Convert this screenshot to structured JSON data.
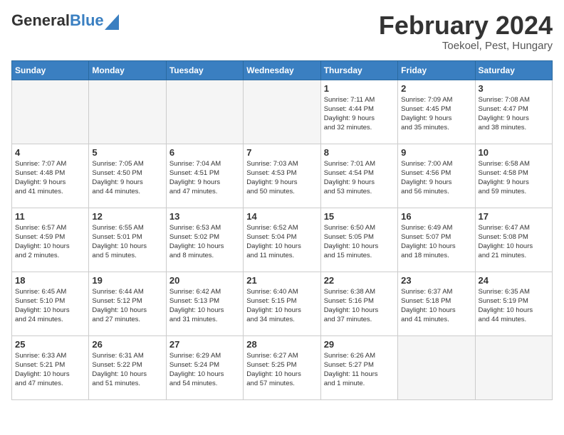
{
  "header": {
    "logo_general": "General",
    "logo_blue": "Blue",
    "title": "February 2024",
    "subtitle": "Toekoel, Pest, Hungary"
  },
  "days_of_week": [
    "Sunday",
    "Monday",
    "Tuesday",
    "Wednesday",
    "Thursday",
    "Friday",
    "Saturday"
  ],
  "weeks": [
    [
      {
        "day": "",
        "info": ""
      },
      {
        "day": "",
        "info": ""
      },
      {
        "day": "",
        "info": ""
      },
      {
        "day": "",
        "info": ""
      },
      {
        "day": "1",
        "info": "Sunrise: 7:11 AM\nSunset: 4:44 PM\nDaylight: 9 hours\nand 32 minutes."
      },
      {
        "day": "2",
        "info": "Sunrise: 7:09 AM\nSunset: 4:45 PM\nDaylight: 9 hours\nand 35 minutes."
      },
      {
        "day": "3",
        "info": "Sunrise: 7:08 AM\nSunset: 4:47 PM\nDaylight: 9 hours\nand 38 minutes."
      }
    ],
    [
      {
        "day": "4",
        "info": "Sunrise: 7:07 AM\nSunset: 4:48 PM\nDaylight: 9 hours\nand 41 minutes."
      },
      {
        "day": "5",
        "info": "Sunrise: 7:05 AM\nSunset: 4:50 PM\nDaylight: 9 hours\nand 44 minutes."
      },
      {
        "day": "6",
        "info": "Sunrise: 7:04 AM\nSunset: 4:51 PM\nDaylight: 9 hours\nand 47 minutes."
      },
      {
        "day": "7",
        "info": "Sunrise: 7:03 AM\nSunset: 4:53 PM\nDaylight: 9 hours\nand 50 minutes."
      },
      {
        "day": "8",
        "info": "Sunrise: 7:01 AM\nSunset: 4:54 PM\nDaylight: 9 hours\nand 53 minutes."
      },
      {
        "day": "9",
        "info": "Sunrise: 7:00 AM\nSunset: 4:56 PM\nDaylight: 9 hours\nand 56 minutes."
      },
      {
        "day": "10",
        "info": "Sunrise: 6:58 AM\nSunset: 4:58 PM\nDaylight: 9 hours\nand 59 minutes."
      }
    ],
    [
      {
        "day": "11",
        "info": "Sunrise: 6:57 AM\nSunset: 4:59 PM\nDaylight: 10 hours\nand 2 minutes."
      },
      {
        "day": "12",
        "info": "Sunrise: 6:55 AM\nSunset: 5:01 PM\nDaylight: 10 hours\nand 5 minutes."
      },
      {
        "day": "13",
        "info": "Sunrise: 6:53 AM\nSunset: 5:02 PM\nDaylight: 10 hours\nand 8 minutes."
      },
      {
        "day": "14",
        "info": "Sunrise: 6:52 AM\nSunset: 5:04 PM\nDaylight: 10 hours\nand 11 minutes."
      },
      {
        "day": "15",
        "info": "Sunrise: 6:50 AM\nSunset: 5:05 PM\nDaylight: 10 hours\nand 15 minutes."
      },
      {
        "day": "16",
        "info": "Sunrise: 6:49 AM\nSunset: 5:07 PM\nDaylight: 10 hours\nand 18 minutes."
      },
      {
        "day": "17",
        "info": "Sunrise: 6:47 AM\nSunset: 5:08 PM\nDaylight: 10 hours\nand 21 minutes."
      }
    ],
    [
      {
        "day": "18",
        "info": "Sunrise: 6:45 AM\nSunset: 5:10 PM\nDaylight: 10 hours\nand 24 minutes."
      },
      {
        "day": "19",
        "info": "Sunrise: 6:44 AM\nSunset: 5:12 PM\nDaylight: 10 hours\nand 27 minutes."
      },
      {
        "day": "20",
        "info": "Sunrise: 6:42 AM\nSunset: 5:13 PM\nDaylight: 10 hours\nand 31 minutes."
      },
      {
        "day": "21",
        "info": "Sunrise: 6:40 AM\nSunset: 5:15 PM\nDaylight: 10 hours\nand 34 minutes."
      },
      {
        "day": "22",
        "info": "Sunrise: 6:38 AM\nSunset: 5:16 PM\nDaylight: 10 hours\nand 37 minutes."
      },
      {
        "day": "23",
        "info": "Sunrise: 6:37 AM\nSunset: 5:18 PM\nDaylight: 10 hours\nand 41 minutes."
      },
      {
        "day": "24",
        "info": "Sunrise: 6:35 AM\nSunset: 5:19 PM\nDaylight: 10 hours\nand 44 minutes."
      }
    ],
    [
      {
        "day": "25",
        "info": "Sunrise: 6:33 AM\nSunset: 5:21 PM\nDaylight: 10 hours\nand 47 minutes."
      },
      {
        "day": "26",
        "info": "Sunrise: 6:31 AM\nSunset: 5:22 PM\nDaylight: 10 hours\nand 51 minutes."
      },
      {
        "day": "27",
        "info": "Sunrise: 6:29 AM\nSunset: 5:24 PM\nDaylight: 10 hours\nand 54 minutes."
      },
      {
        "day": "28",
        "info": "Sunrise: 6:27 AM\nSunset: 5:25 PM\nDaylight: 10 hours\nand 57 minutes."
      },
      {
        "day": "29",
        "info": "Sunrise: 6:26 AM\nSunset: 5:27 PM\nDaylight: 11 hours\nand 1 minute."
      },
      {
        "day": "",
        "info": ""
      },
      {
        "day": "",
        "info": ""
      }
    ]
  ]
}
